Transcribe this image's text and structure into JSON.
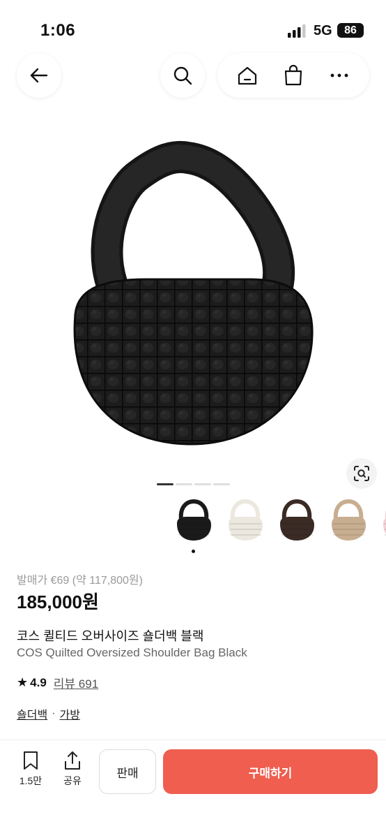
{
  "status_bar": {
    "time": "1:06",
    "network": "5G",
    "battery": "86"
  },
  "nav": {
    "icons": [
      "back-arrow-icon",
      "search-icon",
      "home-icon",
      "shopping-bag-icon",
      "more-icon"
    ]
  },
  "gallery": {
    "image_count": 4,
    "active_index": 0,
    "thumbnails": [
      {
        "name": "black",
        "color": "#1a1a1a",
        "selected": true
      },
      {
        "name": "cream",
        "color": "#ece8df"
      },
      {
        "name": "brown",
        "color": "#3b2b25"
      },
      {
        "name": "beige",
        "color": "#c8ae90"
      },
      {
        "name": "pink",
        "color": "#f2cfd4"
      }
    ]
  },
  "product": {
    "original_price": "발매가 €69 (약 117,800원)",
    "price": "185,000원",
    "name_ko": "코스 퀼티드 오버사이즈 숄더백 블랙",
    "name_en": "COS Quilted Oversized Shoulder Bag Black",
    "rating_star": "★",
    "rating": "4.9",
    "reviews": "리뷰 691",
    "categories": [
      "숄더백",
      "가방"
    ],
    "category_separator": "·"
  },
  "bottom_bar": {
    "save_count": "1.5만",
    "share_label": "공유",
    "sell_label": "판매",
    "buy_label": "구매하기"
  },
  "colors": {
    "buy_button": "#ef5e4f",
    "bag": "#1c1c1c"
  }
}
